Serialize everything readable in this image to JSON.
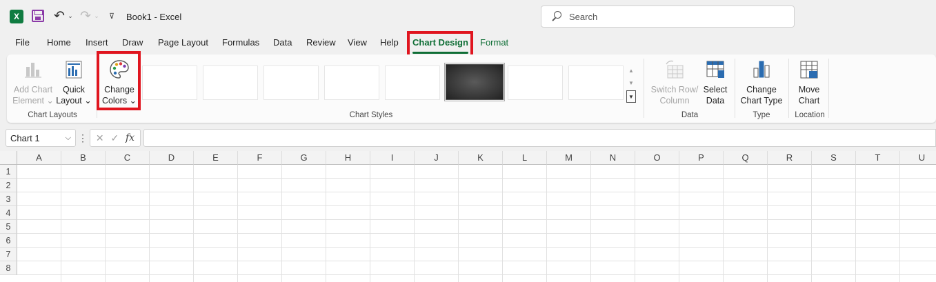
{
  "app": {
    "logo_letter": "X",
    "document_title": "Book1  -  Excel",
    "undo_glyph": "↶",
    "redo_glyph": "↷",
    "caret": "⌄",
    "qat_more": "⊽"
  },
  "search": {
    "placeholder": "Search"
  },
  "tabs": [
    {
      "label": "File"
    },
    {
      "label": "Home"
    },
    {
      "label": "Insert"
    },
    {
      "label": "Draw"
    },
    {
      "label": "Page Layout"
    },
    {
      "label": "Formulas"
    },
    {
      "label": "Data"
    },
    {
      "label": "Review"
    },
    {
      "label": "View"
    },
    {
      "label": "Help"
    },
    {
      "label": "Chart Design"
    },
    {
      "label": "Format"
    }
  ],
  "ribbon": {
    "add_chart_element": {
      "line1": "Add Chart",
      "line2": "Element"
    },
    "quick_layout": {
      "line1": "Quick",
      "line2": "Layout"
    },
    "change_colors": {
      "line1": "Change",
      "line2": "Colors"
    },
    "chart_layouts_label": "Chart Layouts",
    "chart_styles_label": "Chart Styles",
    "switch_row_column": {
      "line1": "Switch Row/",
      "line2": "Column"
    },
    "select_data": {
      "line1": "Select",
      "line2": "Data"
    },
    "data_label": "Data",
    "change_chart_type": {
      "line1": "Change",
      "line2": "Chart Type"
    },
    "type_label": "Type",
    "move_chart": {
      "line1": "Move",
      "line2": "Chart"
    },
    "location_label": "Location",
    "selected_style_index": 5
  },
  "formula_bar": {
    "name_box": "Chart 1",
    "cancel_glyph": "✕",
    "enter_glyph": "✓",
    "fx_label": "fx",
    "formula": ""
  },
  "grid": {
    "columns": [
      "A",
      "B",
      "C",
      "D",
      "E",
      "F",
      "G",
      "H",
      "I",
      "J",
      "K",
      "L",
      "M",
      "N",
      "O",
      "P",
      "Q",
      "R",
      "S",
      "T",
      "U"
    ],
    "rows": [
      "1",
      "2",
      "3",
      "4",
      "5",
      "6",
      "7",
      "8"
    ]
  },
  "colors": {
    "excel_green": "#107c41",
    "active_tab": "#0f6e36",
    "highlight": "#e0151f"
  }
}
